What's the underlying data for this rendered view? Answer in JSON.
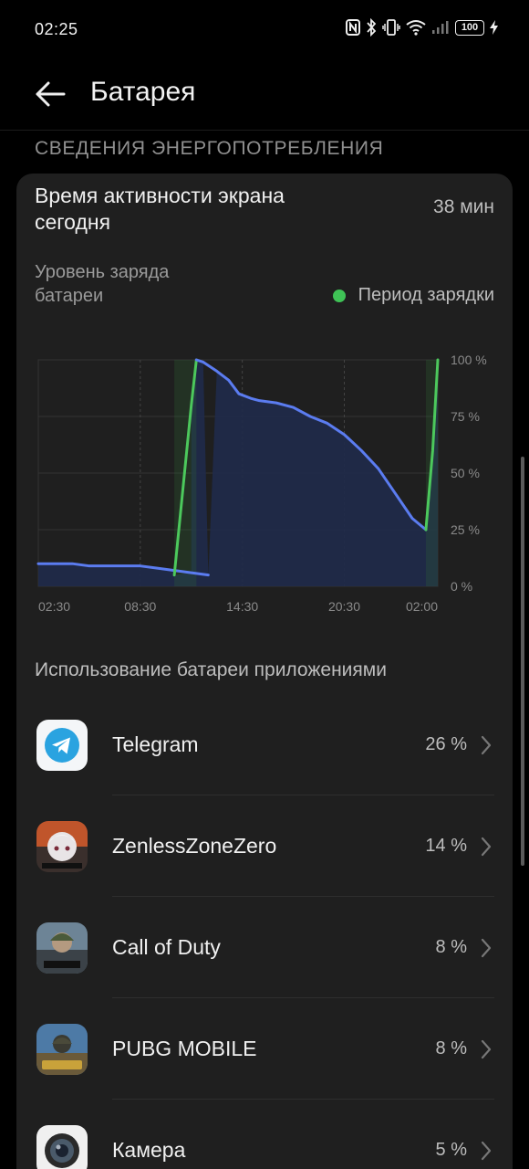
{
  "status_bar": {
    "time": "02:25",
    "battery_level": "100"
  },
  "header": {
    "title": "Батарея"
  },
  "section": {
    "title": "СВЕДЕНИЯ ЭНЕРГОПОТРЕБЛЕНИЯ"
  },
  "screen_time": {
    "label": "Время активности экрана сегодня",
    "value": "38 мин"
  },
  "battery_chart": {
    "label": "Уровень заряда батареи",
    "legend": "Период зарядки",
    "colors": {
      "discharge": "#5b7cf0",
      "charging": "#4cc85c",
      "fill": "#1f2a4a"
    }
  },
  "chart_data": {
    "type": "line",
    "x_tick_labels": [
      "02:30",
      "08:30",
      "14:30",
      "20:30",
      "02:00"
    ],
    "y_tick_labels": [
      "100 %",
      "75 %",
      "50 %",
      "25 %",
      "0 %"
    ],
    "ylim": [
      0,
      100
    ],
    "xlim_hours": [
      0,
      23.5
    ],
    "grid": true,
    "legend_position": "top-right",
    "series": [
      {
        "name": "discharge-1",
        "x": [
          0,
          2,
          3,
          6,
          7,
          8,
          9,
          10
        ],
        "y": [
          10,
          10,
          9,
          9,
          8,
          7,
          6,
          5
        ]
      },
      {
        "name": "charge-1",
        "x": [
          8,
          9,
          9.3
        ],
        "y": [
          5,
          80,
          100
        ]
      },
      {
        "name": "discharge-2",
        "x": [
          9.3,
          9.7,
          10.5,
          11.2,
          11.8,
          12.5,
          13,
          14,
          15,
          16,
          17,
          18,
          19,
          20,
          21,
          22,
          22.8
        ],
        "y": [
          100,
          99,
          95,
          91,
          85,
          83,
          82,
          81,
          79,
          75,
          72,
          67,
          60,
          52,
          41,
          30,
          25
        ]
      },
      {
        "name": "charge-2",
        "x": [
          22.8,
          23.2,
          23.5
        ],
        "y": [
          25,
          60,
          100
        ]
      }
    ]
  },
  "apps": {
    "title": "Использование батареи приложениями",
    "items": [
      {
        "name": "Telegram",
        "percent": "26 %",
        "icon": "telegram-icon"
      },
      {
        "name": "ZenlessZoneZero",
        "percent": "14 %",
        "icon": "zenless-icon"
      },
      {
        "name": "Call of Duty",
        "percent": "8 %",
        "icon": "call-of-duty-icon"
      },
      {
        "name": "PUBG MOBILE",
        "percent": "8 %",
        "icon": "pubg-icon"
      },
      {
        "name": "Камера",
        "percent": "5 %",
        "icon": "camera-icon"
      }
    ]
  }
}
